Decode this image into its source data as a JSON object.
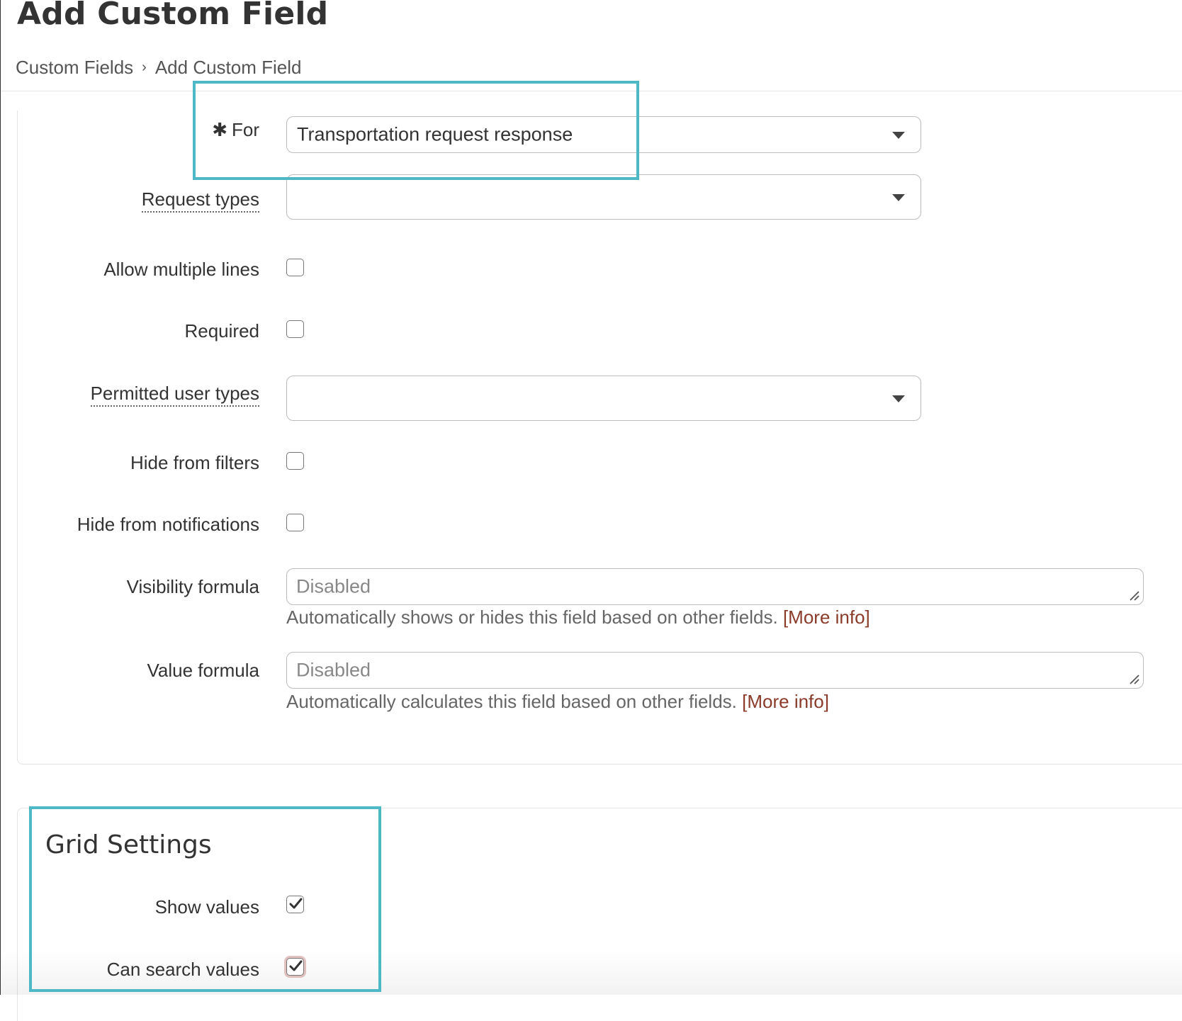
{
  "page": {
    "title": "Add Custom Field"
  },
  "breadcrumb": {
    "items": [
      "Custom Fields",
      "Add Custom Field"
    ],
    "separator": "›"
  },
  "form": {
    "for": {
      "required_marker": "✱",
      "label": "For",
      "value": "Transportation request response"
    },
    "request_types": {
      "label": "Request types",
      "value": ""
    },
    "allow_multiple_lines": {
      "label": "Allow multiple lines",
      "checked": false
    },
    "required": {
      "label": "Required",
      "checked": false
    },
    "permitted_user_types": {
      "label": "Permitted user types",
      "value": ""
    },
    "hide_from_filters": {
      "label": "Hide from filters",
      "checked": false
    },
    "hide_from_notifications": {
      "label": "Hide from notifications",
      "checked": false
    },
    "visibility_formula": {
      "label": "Visibility formula",
      "placeholder": "Disabled",
      "help": "Automatically shows or hides this field based on other fields.",
      "link": "[More info]"
    },
    "value_formula": {
      "label": "Value formula",
      "placeholder": "Disabled",
      "help": "Automatically calculates this field based on other fields.",
      "link": "[More info]"
    }
  },
  "grid_settings": {
    "title": "Grid Settings",
    "show_values": {
      "label": "Show values",
      "checked": true
    },
    "can_search_values": {
      "label": "Can search values",
      "checked": true
    }
  },
  "colors": {
    "highlight": "#4db8c6",
    "link": "#8a3b2a",
    "text": "#333333"
  }
}
